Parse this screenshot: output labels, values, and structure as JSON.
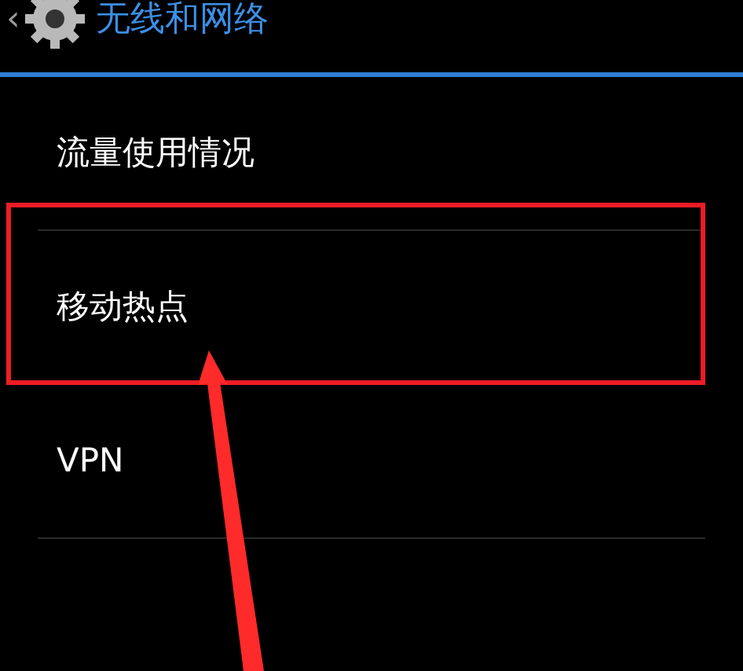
{
  "header": {
    "back": "‹",
    "title": "无线和网络"
  },
  "items": [
    {
      "label": "流量使用情况",
      "highlighted": false
    },
    {
      "label": "移动热点",
      "highlighted": true
    },
    {
      "label": "VPN",
      "highlighted": false
    }
  ]
}
